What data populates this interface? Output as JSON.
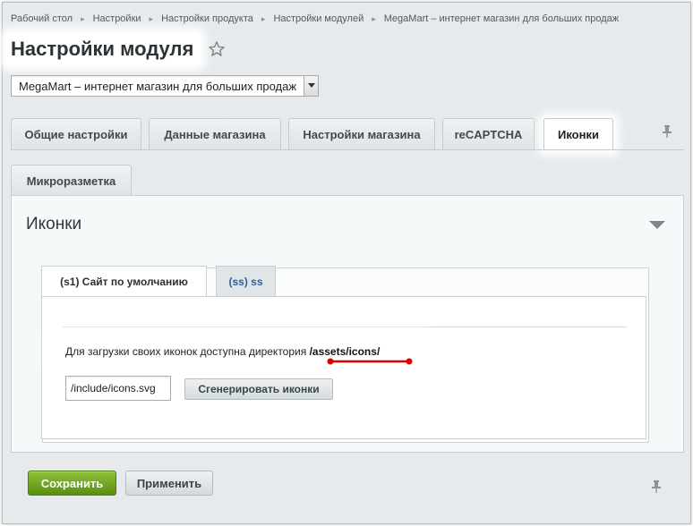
{
  "breadcrumb": [
    "Рабочий стол",
    "Настройки",
    "Настройки продукта",
    "Настройки модулей",
    "MegaMart – интернет магазин для больших продаж"
  ],
  "page": {
    "title": "Настройки модуля"
  },
  "site_select": {
    "value": "MegaMart – интернет магазин для больших продаж"
  },
  "tabs": [
    {
      "label": "Общие настройки",
      "active": false
    },
    {
      "label": "Данные магазина",
      "active": false
    },
    {
      "label": "Настройки магазина",
      "active": false
    },
    {
      "label": "reCAPTCHA",
      "active": false
    },
    {
      "label": "Иконки",
      "active": true
    },
    {
      "label": "Микроразметка",
      "active": false
    }
  ],
  "section": {
    "title": "Иконки"
  },
  "site_tabs": [
    {
      "label": "(s1) Сайт по умолчанию",
      "active": true
    },
    {
      "label": "(ss) ss",
      "active": false
    }
  ],
  "content": {
    "hint_text": "Для загрузки своих иконок доступна директория ",
    "hint_path": "/assets/icons/",
    "input_value": "/include/icons.svg",
    "generate_label": "Сгенерировать иконки"
  },
  "footer": {
    "save_label": "Сохранить",
    "apply_label": "Применить"
  },
  "colors": {
    "save_green": "#6a9e1f",
    "highlight_red": "#e00000",
    "link_blue": "#2b5ea4"
  }
}
